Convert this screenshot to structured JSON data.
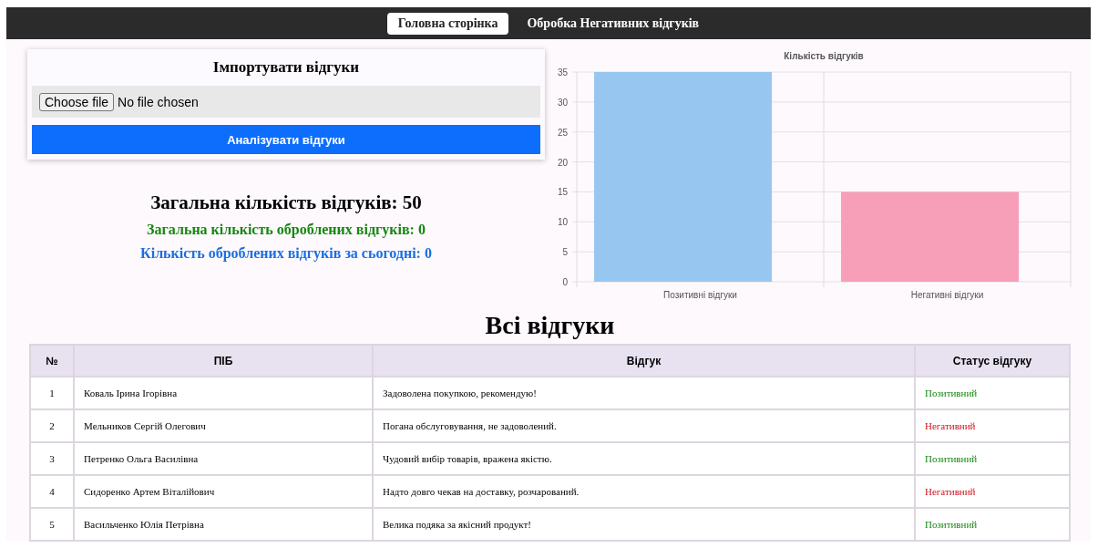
{
  "nav": [
    {
      "label": "Головна сторінка",
      "selected": true
    },
    {
      "label": "Обробка Негативних відгуків",
      "selected": false
    }
  ],
  "import_card": {
    "title": "Імпортувати відгуки",
    "file_button": "Choose file",
    "file_status": "No file chosen",
    "submit": "Аналізувати відгуки"
  },
  "stats": {
    "total": "Загальна кількість відгуків: 50",
    "processed": "Загальна кількість оброблених відгуків: 0",
    "today": "Кількість оброблених відгуків за сьогодні: 0"
  },
  "chart_data": {
    "type": "bar",
    "title": "Кількість відгуків",
    "categories": [
      "Позитивні відгуки",
      "Негативні відгуки"
    ],
    "series": [
      {
        "color": "#97c7f0",
        "values": [
          35,
          null
        ]
      },
      {
        "color": "#f79eb9",
        "values": [
          null,
          15
        ]
      }
    ],
    "ylim": [
      0,
      35
    ],
    "yticks": [
      0,
      5,
      10,
      15,
      20,
      25,
      30,
      35
    ],
    "grid": true
  },
  "table": {
    "title": "Всі відгуки",
    "columns": [
      "№",
      "ПІБ",
      "Відгук",
      "Статус відгуку"
    ],
    "rows": [
      {
        "number": "1",
        "name": "Коваль Ірина Ігорівна",
        "review": "Задоволена покупкою, рекомендую!",
        "status": "Позитивний",
        "kind": "positive"
      },
      {
        "number": "2",
        "name": "Мельников Сергій Олегович",
        "review": "Погана обслуговування, не задоволений.",
        "status": "Негативний",
        "kind": "negative"
      },
      {
        "number": "3",
        "name": "Петренко Ольга Василівна",
        "review": "Чудовий вибір товарів, вражена якістю.",
        "status": "Позитивний",
        "kind": "positive"
      },
      {
        "number": "4",
        "name": "Сидоренко Артем Віталійович",
        "review": "Надто довго чекав на доставку, розчарований.",
        "status": "Негативний",
        "kind": "negative"
      },
      {
        "number": "5",
        "name": "Васильченко Юлія Петрівна",
        "review": "Велика подяка за якісний продукт!",
        "status": "Позитивний",
        "kind": "positive"
      }
    ]
  }
}
